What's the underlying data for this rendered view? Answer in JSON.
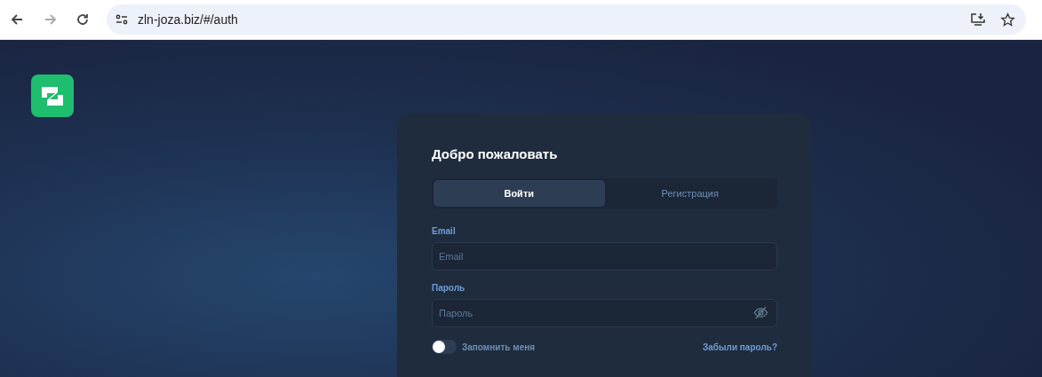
{
  "browser": {
    "url": "zln-joza.biz/#/auth"
  },
  "card": {
    "title": "Добро пожаловать",
    "tabs": [
      {
        "label": "Войти",
        "selected": true
      },
      {
        "label": "Регистрация",
        "selected": false
      }
    ],
    "fields": [
      {
        "kind": "text",
        "label": "Email",
        "placeholder": "Email"
      },
      {
        "kind": "password",
        "label": "Пароль",
        "placeholder": "Пароль"
      }
    ],
    "remember": {
      "label": "Запомнить меня",
      "on": false
    },
    "forgot_link": "Забыли пароль?"
  }
}
